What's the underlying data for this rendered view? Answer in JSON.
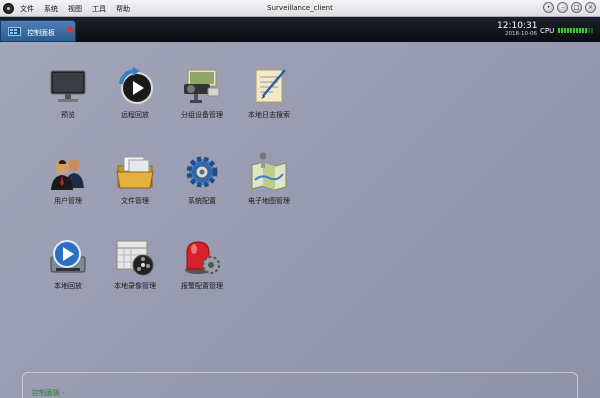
{
  "window": {
    "title": "Surveillance_client",
    "menu": [
      "文件",
      "系统",
      "视图",
      "工具",
      "帮助"
    ]
  },
  "tab": {
    "label": "控制面板"
  },
  "status": {
    "time": "12:10:31",
    "date": "2018-10-06",
    "cpu_label": "CPU",
    "cpu_level": 0.85
  },
  "grid": [
    {
      "label": "预览",
      "icon": "monitor-icon"
    },
    {
      "label": "远程回放",
      "icon": "remote-playback-icon"
    },
    {
      "label": "分组设备管理",
      "icon": "device-group-icon"
    },
    {
      "label": "本地日志搜索",
      "icon": "log-search-icon"
    },
    {
      "label": "用户管理",
      "icon": "users-icon"
    },
    {
      "label": "文件管理",
      "icon": "folder-icon"
    },
    {
      "label": "系统配置",
      "icon": "gear-icon"
    },
    {
      "label": "电子地图管理",
      "icon": "map-icon"
    },
    {
      "label": "本地回放",
      "icon": "local-playback-icon"
    },
    {
      "label": "本地录像管理",
      "icon": "local-record-icon"
    },
    {
      "label": "报警配置管理",
      "icon": "alarm-icon"
    }
  ],
  "bottom": {
    "label": "控制面板 -"
  },
  "colors": {
    "tab": "#2a5b93",
    "accent_green": "#38d12b",
    "background": "#9fa2b6"
  }
}
